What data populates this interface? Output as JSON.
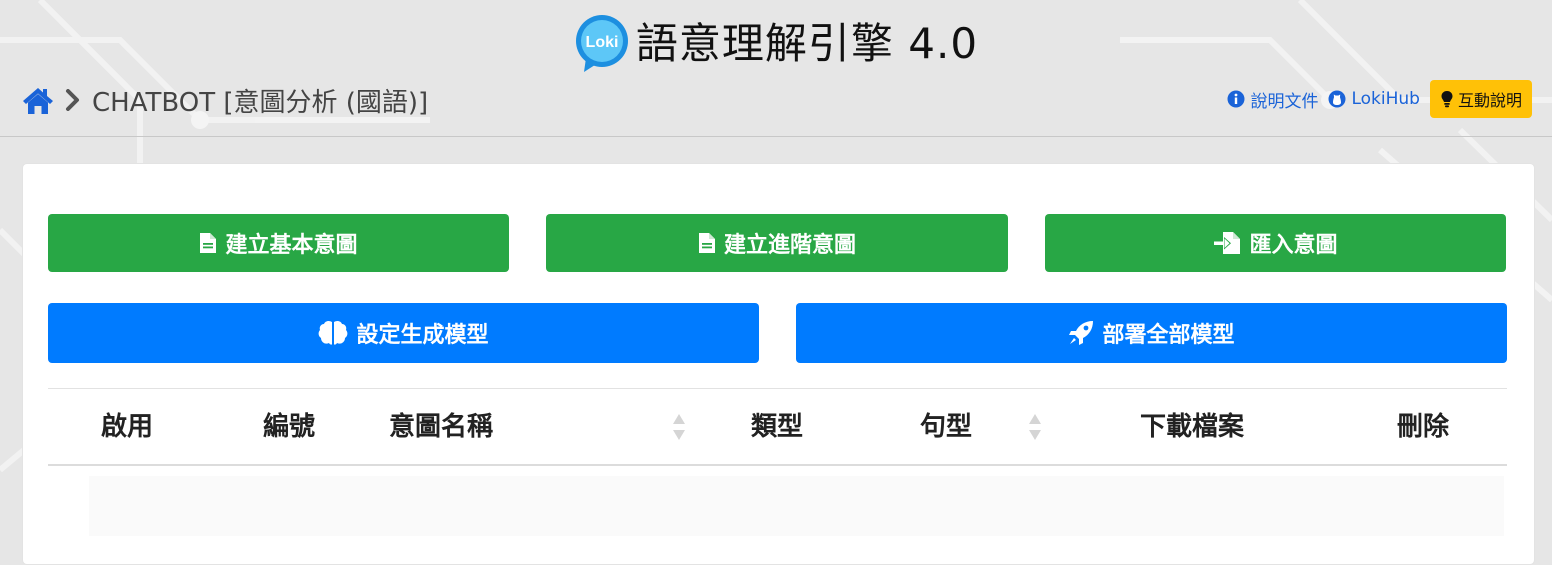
{
  "header": {
    "logo_text": "Loki",
    "title": "語意理解引擎 4.0",
    "breadcrumb": {
      "home_icon": "home-icon",
      "separator_icon": "chevron-right-icon",
      "current": "CHATBOT [意圖分析 (國語)]"
    },
    "links": {
      "docs_label": "說明文件",
      "docs_icon": "info-circle-icon",
      "hub_label": "LokiHub",
      "hub_icon": "github-icon",
      "help_label": "互動說明",
      "help_icon": "lightbulb-icon"
    }
  },
  "actions": {
    "create_basic": "建立基本意圖",
    "create_advanced": "建立進階意圖",
    "import": "匯入意圖",
    "set_model": "設定生成模型",
    "deploy_all": "部署全部模型"
  },
  "table": {
    "columns": [
      "啟用",
      "編號",
      "意圖名稱",
      "類型",
      "句型",
      "下載檔案",
      "刪除"
    ],
    "rows": []
  },
  "colors": {
    "green": "#28a745",
    "blue": "#007bff",
    "yellow": "#ffc107",
    "link": "#1a63d8"
  }
}
